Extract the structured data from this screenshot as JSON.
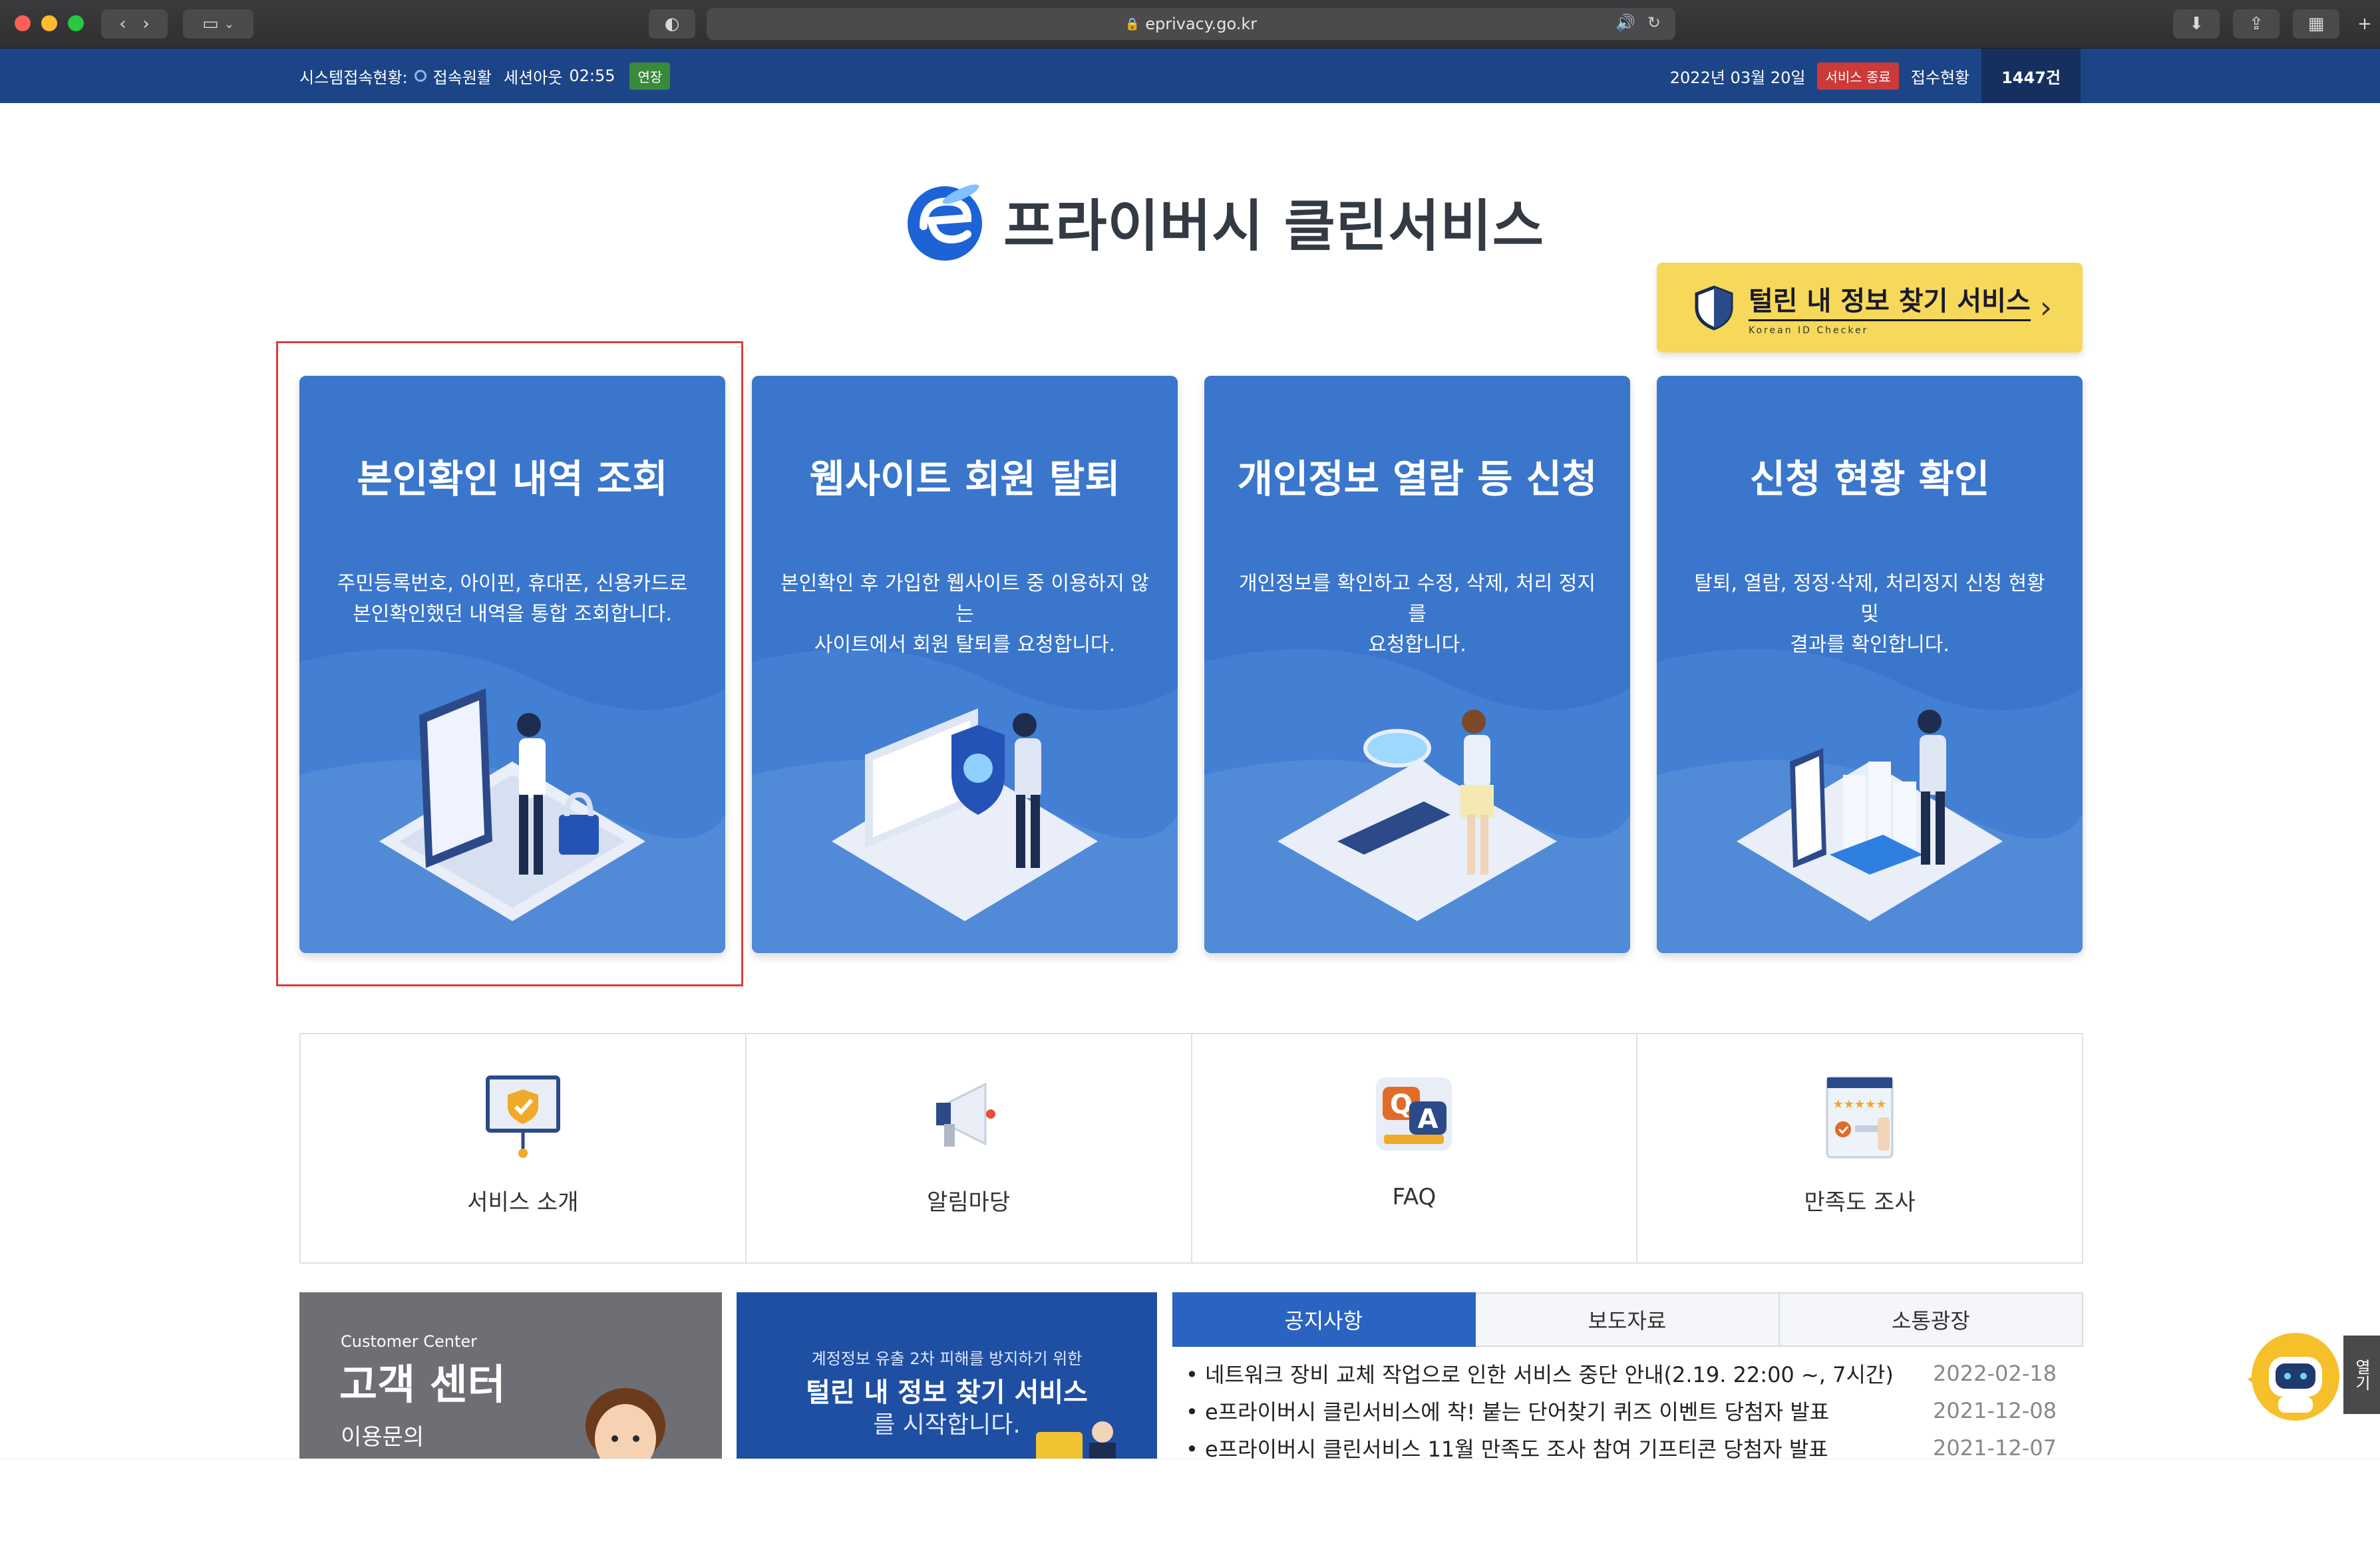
{
  "browser": {
    "url": "eprivacy.go.kr"
  },
  "topbar": {
    "status_label": "시스템접속현황:",
    "status_text": "접속원활",
    "session_label": "세션아웃",
    "session_time": "02:55",
    "extend_label": "연장",
    "date": "2022년 03월 20일",
    "logout_label": "서비스 종료",
    "count_label": "접수현황",
    "count_value": "1447건"
  },
  "logo": {
    "text": "프라이버시 클린서비스"
  },
  "cta": {
    "title": "털린 내 정보 찾기 서비스",
    "subtitle": "Korean ID Checker"
  },
  "cards": [
    {
      "title": "본인확인 내역 조회",
      "desc1": "주민등록번호, 아이핀, 휴대폰, 신용카드로",
      "desc2": "본인확인했던 내역을 통합 조회합니다."
    },
    {
      "title": "웹사이트 회원 탈퇴",
      "desc1": "본인확인 후 가입한 웹사이트 중 이용하지 않는",
      "desc2": "사이트에서 회원 탈퇴를 요청합니다."
    },
    {
      "title": "개인정보 열람 등 신청",
      "desc1": "개인정보를 확인하고 수정, 삭제, 처리 정지를",
      "desc2": "요청합니다."
    },
    {
      "title": "신청 현황 확인",
      "desc1": "탈퇴, 열람, 정정·삭제, 처리정지 신청 현황 및",
      "desc2": "결과를 확인합니다."
    }
  ],
  "quick_links": [
    {
      "label": "서비스 소개"
    },
    {
      "label": "알림마당"
    },
    {
      "label": "FAQ"
    },
    {
      "label": "만족도 조사"
    }
  ],
  "customer_center": {
    "en": "Customer Center",
    "ko": "고객 센터",
    "sub": "이용문의"
  },
  "banner": {
    "line1": "계정정보 유출 2차 피해를 방지하기 위한",
    "line2": "털린 내 정보 찾기 서비스",
    "line3": "를 시작합니다."
  },
  "news": {
    "tabs": [
      "공지사항",
      "보도자료",
      "소통광장"
    ],
    "items": [
      {
        "title": "네트워크 장비 교체 작업으로 인한 서비스 중단 안내(2.19. 22:00 ~, 7시간)",
        "date": "2022-02-18"
      },
      {
        "title": "e프라이버시 클린서비스에 착! 붙는 단어찾기 퀴즈 이벤트 당첨자 발표",
        "date": "2021-12-08"
      },
      {
        "title": "e프라이버시 클린서비스 11월 만족도 조사 참여 기프티콘 당첨자 발표",
        "date": "2021-12-07"
      }
    ]
  },
  "chatbot": {
    "open_label": "열기"
  },
  "colors": {
    "brand_blue": "#1c4587",
    "card_blue": "#3a76cc",
    "cta_yellow": "#f6d95a",
    "highlight_red": "#e03a3a"
  }
}
